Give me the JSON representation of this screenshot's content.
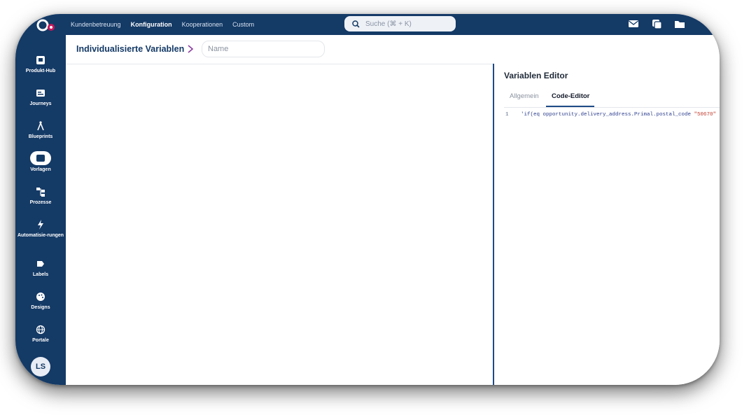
{
  "topnav": {
    "items": [
      "Kundenbetreuung",
      "Konfiguration",
      "Kooperationen",
      "Custom"
    ],
    "active_index": 1
  },
  "search": {
    "placeholder": "Suche (⌘ + K)"
  },
  "top_icons": [
    "mail-icon",
    "copy-icon",
    "folder-icon"
  ],
  "sidebar": {
    "items": [
      {
        "label": "Produkt-Hub",
        "icon": "product-hub-icon"
      },
      {
        "label": "Journeys",
        "icon": "journeys-icon"
      },
      {
        "label": "Blueprints",
        "icon": "compass-icon"
      },
      {
        "label": "Vorlagen",
        "icon": "templates-icon",
        "active": true
      },
      {
        "label": "Prozesse",
        "icon": "process-icon"
      },
      {
        "label": "Automatisie-rungen",
        "icon": "lightning-icon"
      },
      {
        "label": "Labels",
        "icon": "label-icon"
      },
      {
        "label": "Designs",
        "icon": "palette-icon"
      },
      {
        "label": "Portale",
        "icon": "globe-icon"
      }
    ],
    "avatar": "LS"
  },
  "header": {
    "title": "Individualisierte Variablen",
    "name_placeholder": "Name"
  },
  "editor": {
    "title": "Variablen Editor",
    "tabs": [
      "Allgemein",
      "Code-Editor"
    ],
    "active_tab": 1,
    "line_number": "1",
    "code_prefix": "'if(eq opportunity.delivery_address.Primal.postal_code ",
    "code_string": "\"50670\""
  },
  "colors": {
    "brand": "#143a66",
    "accent": "#1f4a86",
    "chevron": "#8b3fa0"
  }
}
